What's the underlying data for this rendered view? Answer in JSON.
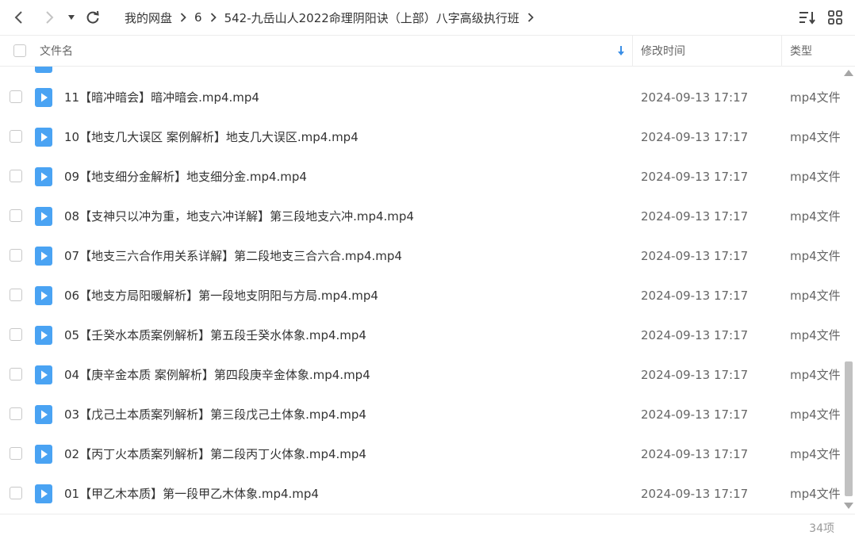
{
  "breadcrumb": {
    "items": [
      "我的网盘",
      "6",
      "542-九岳山人2022命理阴阳诀（上部）八字高级执行班"
    ]
  },
  "columns": {
    "name": "文件名",
    "time": "修改时间",
    "type": "类型"
  },
  "files": [
    {
      "name": "11【暗冲暗会】暗冲暗会.mp4.mp4",
      "time": "2024-09-13 17:17",
      "type": "mp4文件"
    },
    {
      "name": "10【地支几大误区 案例解析】地支几大误区.mp4.mp4",
      "time": "2024-09-13 17:17",
      "type": "mp4文件"
    },
    {
      "name": "09【地支细分金解析】地支细分金.mp4.mp4",
      "time": "2024-09-13 17:17",
      "type": "mp4文件"
    },
    {
      "name": "08【支神只以冲为重，地支六冲详解】第三段地支六冲.mp4.mp4",
      "time": "2024-09-13 17:17",
      "type": "mp4文件"
    },
    {
      "name": "07【地支三六合作用关系详解】第二段地支三合六合.mp4.mp4",
      "time": "2024-09-13 17:17",
      "type": "mp4文件"
    },
    {
      "name": "06【地支方局阳暖解析】第一段地支阴阳与方局.mp4.mp4",
      "time": "2024-09-13 17:17",
      "type": "mp4文件"
    },
    {
      "name": "05【壬癸水本质案例解析】第五段壬癸水体象.mp4.mp4",
      "time": "2024-09-13 17:17",
      "type": "mp4文件"
    },
    {
      "name": "04【庚辛金本质 案例解析】第四段庚辛金体象.mp4.mp4",
      "time": "2024-09-13 17:17",
      "type": "mp4文件"
    },
    {
      "name": "03【戊己土本质案列解析】第三段戊己土体象.mp4.mp4",
      "time": "2024-09-13 17:17",
      "type": "mp4文件"
    },
    {
      "name": "02【丙丁火本质案列解析】第二段丙丁火体象.mp4.mp4",
      "time": "2024-09-13 17:17",
      "type": "mp4文件"
    },
    {
      "name": "01【甲乙木本质】第一段甲乙木体象.mp4.mp4",
      "time": "2024-09-13 17:17",
      "type": "mp4文件"
    }
  ],
  "footer": {
    "count": "34项"
  },
  "colors": {
    "accent": "#3a8ee6",
    "file_icon": "#4aa3f3"
  },
  "icons": [
    "back-arrow-icon",
    "forward-arrow-icon",
    "dropdown-icon",
    "refresh-icon",
    "chevron-right-icon",
    "sort-icon",
    "grid-view-icon",
    "sort-down-arrow-icon",
    "video-file-icon"
  ]
}
